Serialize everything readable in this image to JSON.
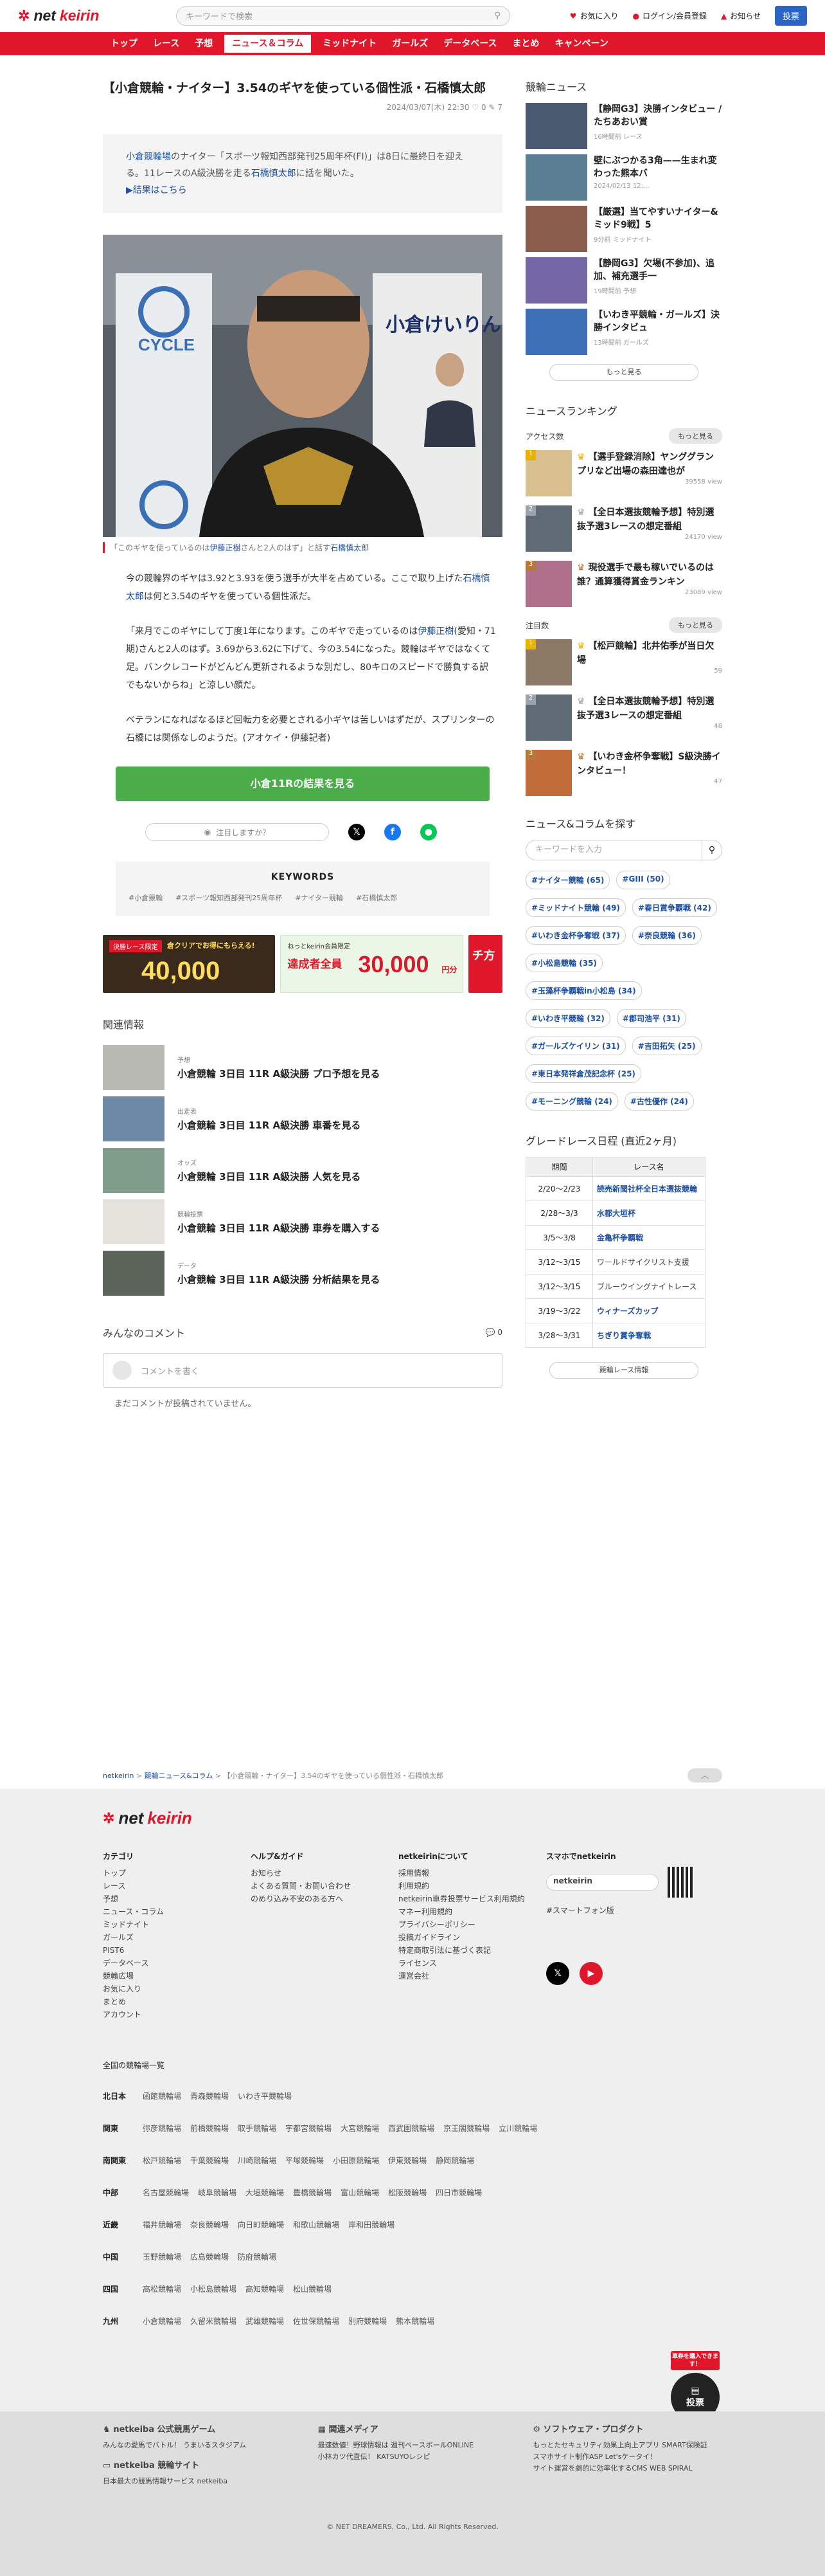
{
  "header": {
    "logo_a": "net",
    "logo_b": "keirin",
    "search_placeholder": "キーワードで検索",
    "favorite": "お気に入り",
    "login": "ログイン/会員登録",
    "notice": "お知らせ",
    "post": "投票"
  },
  "nav": [
    "トップ",
    "レース",
    "予想",
    "ニュース＆コラム",
    "ミッドナイト",
    "ガールズ",
    "データベース",
    "まとめ",
    "キャンペーン"
  ],
  "article": {
    "title": "【小倉競輪・ナイター】3.54のギヤを使っている個性派・石橋慎太郎",
    "meta": "2024/03/07(木) 22:30",
    "likes": "0",
    "comments": "7",
    "lead_a": "小倉競輪場",
    "lead_b": "のナイター「スポーツ報知西部発刊25周年杯(FI)」は8日に最終日を迎える。11レースのA級決勝を走る",
    "lead_c": "石橋慎太郎",
    "lead_d": "に話を聞いた。",
    "lead_link": "▶結果はこちら",
    "caption_a": "「このギヤを使っているのは",
    "caption_b": "伊藤正樹",
    "caption_c": "さんと2人のはず」と話す",
    "caption_d": "石橋慎太郎",
    "p1": "今の競輪界のギヤは3.92と3.93を使う選手が大半を占めている。ここで取り上げた",
    "p1_link": "石橋慎太郎",
    "p1_tail": "は何と3.54のギヤを使っている個性派だ。",
    "p2a": "「来月でこのギヤにして丁度1年になります。このギヤで走っているのは",
    "p2_link": "伊藤正樹",
    "p2b": "(愛知・71期)さんと2人のはず。3.69から3.62に下げて、今の3.54になった。競輪はギヤではなくて足。バンクレコードがどんどん更新されるような別だし、80キロのスピードで勝負する訳でもないからね」と涼しい顔だ。",
    "p3": "ベテランになればなるほど回転力を必要とされる小ギヤは苦しいはずだが、スプリンターの石橋には関係なしのようだ。(アオケイ・伊藤記者)",
    "cta": "小倉11Rの結果を見る",
    "notice_btn": "注目しますか？",
    "keywords_head": "KEYWORDS",
    "keywords": [
      "#小倉競輪",
      "#スポーツ報知西部発刊25周年杯",
      "#ナイター競輪",
      "#石橋慎太郎"
    ]
  },
  "banners": {
    "b1_top": "決勝レース限定",
    "b1_sub": "倉クリアでお得にもらえる!",
    "b1_num": "40,000",
    "b2_top": "ねっとkeirin会員限定",
    "b2_sub": "達成者全員",
    "b2_num": "30,000",
    "b2_unit": "円分",
    "b3": "チ方"
  },
  "related": {
    "heading": "関連情報",
    "items": [
      {
        "tag": "予想",
        "title": "小倉競輪 3日目 11R A級決勝 プロ予想を見る"
      },
      {
        "tag": "出走表",
        "title": "小倉競輪 3日目 11R A級決勝 車番を見る"
      },
      {
        "tag": "オッズ",
        "title": "小倉競輪 3日目 11R A級決勝 人気を見る"
      },
      {
        "tag": "競輪投票",
        "title": "小倉競輪 3日目 11R A級決勝 車券を購入する"
      },
      {
        "tag": "データ",
        "title": "小倉競輪 3日目 11R A級決勝 分析結果を見る"
      }
    ]
  },
  "comments": {
    "heading": "みんなのコメント",
    "count": "0",
    "placeholder": "コメントを書く",
    "empty": "まだコメントが投稿されていません。"
  },
  "side": {
    "news_heading": "競輪ニュース",
    "news": [
      {
        "title": "【静岡G3】決勝インタビュー / たちあおい賞",
        "meta": "16時間前 レース"
      },
      {
        "title": "壁にぶつかる3角——生まれ変わった熊本バ",
        "meta": "2024/02/13 12:…"
      },
      {
        "title": "【厳選】当てやすいナイター&ミッド9戦】5",
        "meta": "9分前 ミッドナイト"
      },
      {
        "title": "【静岡G3】欠場(不参加)、追加、補充選手一",
        "meta": "19時間前 予想"
      },
      {
        "title": "【いわき平競輪・ガールズ】決勝インタビュ",
        "meta": "13時間前 ガールズ"
      }
    ],
    "news_more": "もっと見る",
    "ranking_heading": "ニュースランキング",
    "access_label": "アクセス数",
    "rank_more": "もっと見る",
    "access": [
      {
        "no": "1",
        "title": "【選手登録消除】ヤンググランプリなど出場の森田達也が",
        "view": "39558 view"
      },
      {
        "no": "2",
        "title": "【全日本選抜競輪予想】特別選抜予選3レースの想定番組",
        "view": "24170 view"
      },
      {
        "no": "3",
        "title": "現役選手で最も稼いでいるのは誰？通算獲得賞金ランキン",
        "view": "23089 view"
      }
    ],
    "watch_label": "注目数",
    "watch": [
      {
        "no": "1",
        "title": "【松戸競輪】北井佑季が当日欠場",
        "view": "59"
      },
      {
        "no": "2",
        "title": "【全日本選抜競輪予想】特別選抜予選3レースの想定番組",
        "view": "48"
      },
      {
        "no": "3",
        "title": "【いわき金杯争奪戦】S級決勝インタビュー！",
        "view": "47"
      }
    ],
    "find_heading": "ニュース&コラムを探す",
    "find_placeholder": "キーワードを入力",
    "tags": [
      "#ナイター競輪 (65)",
      "#GIII (50)",
      "#ミッドナイト競輪 (49)",
      "#春日賞争覇戦 (42)",
      "#いわき金杯争奪戦 (37)",
      "#奈良競輪 (36)",
      "#小松島競輪 (35)",
      "#玉藻杯争覇戦in小松島 (34)",
      "#いわき平競輪 (32)",
      "#郡司浩平 (31)",
      "#ガールズケイリン (31)",
      "#吉田拓矢 (25)",
      "#東日本発祥倉茂記念杯 (25)",
      "#モーニング競輪 (24)",
      "#古性優作 (24)"
    ],
    "grade_heading": "グレードレース日程 (直近2ヶ月)",
    "grade_cols": [
      "期間",
      "レース名"
    ],
    "grade": [
      {
        "d": "2/20〜2/23",
        "n": "読売新聞社杯全日本選抜競輪",
        "plain": false
      },
      {
        "d": "2/28〜3/3",
        "n": "水都大垣杯",
        "plain": false
      },
      {
        "d": "3/5〜3/8",
        "n": "金亀杯争覇戦",
        "plain": false
      },
      {
        "d": "3/12〜3/15",
        "n": "ワールドサイクリスト支援",
        "plain": true
      },
      {
        "d": "3/12〜3/15",
        "n": "ブルーウイングナイトレース",
        "plain": true
      },
      {
        "d": "3/19〜3/22",
        "n": "ウィナーズカップ",
        "plain": false
      },
      {
        "d": "3/28〜3/31",
        "n": "ちぎり賞争奪戦",
        "plain": false
      }
    ],
    "grade_more": "競輪レース情報"
  },
  "crumb": {
    "a": "netkeirin",
    "b": "競輪ニュース&コラム",
    "c": "【小倉競輪・ナイター】3.54のギヤを使っている個性派・石橋慎太郎"
  },
  "footer": {
    "cols": [
      {
        "h": "カテゴリ",
        "items": [
          "トップ",
          "レース",
          "予想",
          "ニュース・コラム",
          "ミッドナイト",
          "ガールズ",
          "PIST6",
          "データベース",
          "競輪広場",
          "お気に入り",
          "まとめ",
          "アカウント"
        ]
      },
      {
        "h": "ヘルプ&ガイド",
        "items": [
          "お知らせ",
          "よくある質問・お問い合わせ",
          "のめり込み不安のある方へ"
        ]
      },
      {
        "h": "netkeirinについて",
        "items": [
          "採用情報",
          "利用規約",
          "netkeirin車券投票サービス利用規約",
          "マネー利用規約",
          "プライバシーポリシー",
          "投稿ガイドライン",
          "特定商取引法に基づく表記",
          "ライセンス",
          "運営会社"
        ]
      },
      {
        "h": "スマホでnetkeirin",
        "items": [
          "netkeirin",
          "#スマートフォン版"
        ]
      }
    ],
    "tracks_heading": "全国の競輪場一覧",
    "tracks": [
      {
        "r": "北日本",
        "t": [
          "函館競輪場",
          "青森競輪場",
          "いわき平競輪場"
        ]
      },
      {
        "r": "関東",
        "t": [
          "弥彦競輪場",
          "前橋競輪場",
          "取手競輪場",
          "宇都宮競輪場",
          "大宮競輪場",
          "西武園競輪場",
          "京王閣競輪場",
          "立川競輪場"
        ]
      },
      {
        "r": "南関東",
        "t": [
          "松戸競輪場",
          "千葉競輪場",
          "川崎競輪場",
          "平塚競輪場",
          "小田原競輪場",
          "伊東競輪場",
          "静岡競輪場"
        ]
      },
      {
        "r": "中部",
        "t": [
          "名古屋競輪場",
          "岐阜競輪場",
          "大垣競輪場",
          "豊橋競輪場",
          "富山競輪場",
          "松阪競輪場",
          "四日市競輪場"
        ]
      },
      {
        "r": "近畿",
        "t": [
          "福井競輪場",
          "奈良競輪場",
          "向日町競輪場",
          "和歌山競輪場",
          "岸和田競輪場"
        ]
      },
      {
        "r": "中国",
        "t": [
          "玉野競輪場",
          "広島競輪場",
          "防府競輪場"
        ]
      },
      {
        "r": "四国",
        "t": [
          "高松競輪場",
          "小松島競輪場",
          "高知競輪場",
          "松山競輪場"
        ]
      },
      {
        "r": "九州",
        "t": [
          "小倉競輪場",
          "久留米競輪場",
          "武雄競輪場",
          "佐世保競輪場",
          "別府競輪場",
          "熊本競輪場"
        ]
      }
    ],
    "b1h": "netkeiba 公式競馬ゲーム",
    "b1": "みんなの愛馬でバトル！ うまいるスタジアム",
    "b2h": "netkeiba 競輪サイト",
    "b2": "日本最大の競馬情報サービス netkeiba",
    "b3h": "関連メディア",
    "b3": "最速数値！野球情報は 週刊ベースボールONLINE",
    "b3b": "小林カツ代直伝！ KATSUYOレシピ",
    "b4h": "ソフトウェア・プロダクト",
    "b4": "もっとたセキュリティ効果上向上アプリ SMART保険証",
    "b4b": "スマホサイト制作ASP Let'sケータイ！",
    "b4c": "サイト運営を劇的に効率化するCMS WEB SPIRAL",
    "copyright": "© NET DREAMERS, Co., Ltd. All Rights Reserved.",
    "fab": "投票",
    "fab_bubble": "車券を購入できます！"
  },
  "colors": {
    "brand": "#e0172b",
    "link": "#1e50a2",
    "cta": "#4bad4a"
  }
}
